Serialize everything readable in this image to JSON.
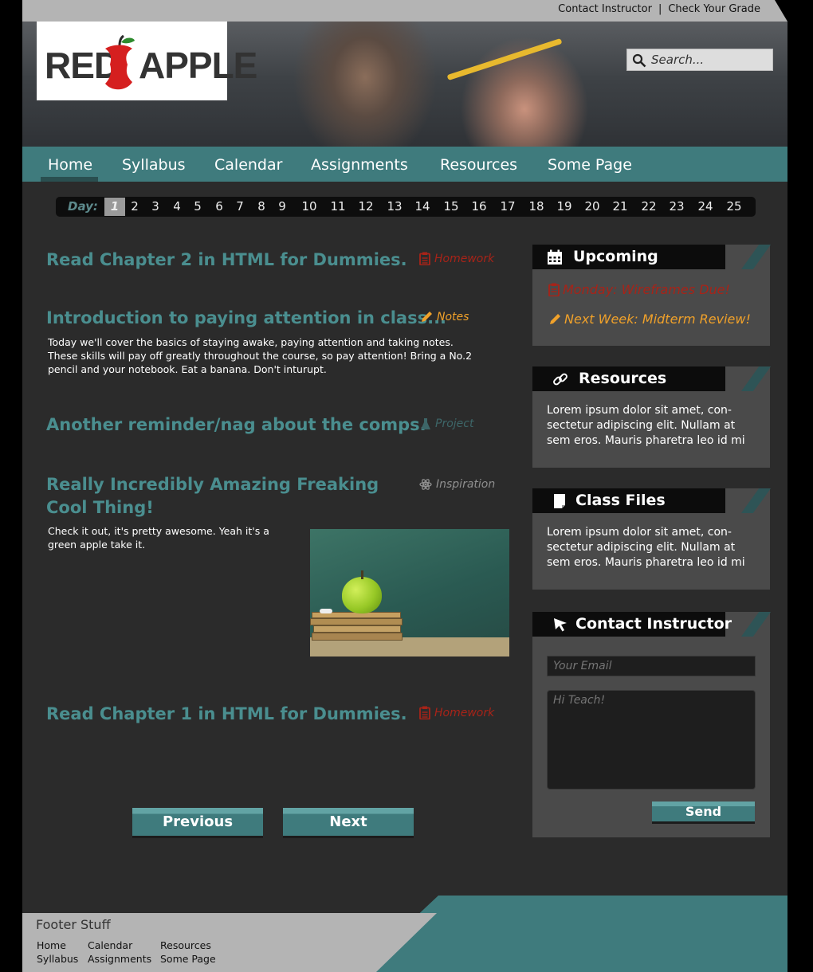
{
  "topbar": {
    "contact": "Contact Instructor",
    "separator": "|",
    "grade": "Check Your Grade"
  },
  "logo": {
    "left_word": "RED",
    "right_word": "APPLE"
  },
  "search": {
    "placeholder": "Search..."
  },
  "nav": {
    "items": [
      "Home",
      "Syllabus",
      "Calendar",
      "Assignments",
      "Resources",
      "Some Page"
    ],
    "active": "Home"
  },
  "daybar": {
    "label": "Day:",
    "active": "1",
    "days": [
      "1",
      "2",
      "3",
      "4",
      "5",
      "6",
      "7",
      "8",
      "9",
      "10",
      "11",
      "12",
      "13",
      "14",
      "15",
      "16",
      "17",
      "18",
      "19",
      "20",
      "21",
      "22",
      "23",
      "24",
      "25"
    ]
  },
  "posts": [
    {
      "title": "Read Chapter 2 in HTML for Dummies.",
      "tag": "Homework",
      "tag_icon": "clipboard-icon"
    },
    {
      "title": "Introduction to paying attention in class...",
      "tag": "Notes",
      "tag_icon": "pencil-icon",
      "body": "Today we'll cover the basics of staying awake, paying attention and taking notes. These skills will pay off greatly throughout the course, so pay attention! Bring a No.2 pencil and your notebook. Eat a banana. Don't inturupt."
    },
    {
      "title": "Another reminder/nag about the comps.",
      "tag": "Project",
      "tag_icon": "flask-icon"
    },
    {
      "title_line1": "Really Incredibly Amazing Freaking",
      "title_line2": "Cool Thing!",
      "tag": "Inspiration",
      "tag_icon": "atom-icon",
      "body": "Check it out, it's pretty awesome. Yeah it's a green apple take it."
    },
    {
      "title": "Read Chapter 1 in HTML for Dummies.",
      "tag": "Homework",
      "tag_icon": "clipboard-icon"
    }
  ],
  "pager": {
    "previous": "Previous",
    "next": "Next"
  },
  "sidebar": {
    "upcoming": {
      "title": "Upcoming",
      "items": [
        {
          "text": "Monday: Wireframes Due!",
          "icon": "clipboard-icon"
        },
        {
          "text": "Next Week: Midterm Review!",
          "icon": "pencil-icon"
        }
      ]
    },
    "resources": {
      "title": "Resources",
      "text": "Lorem ipsum dolor sit amet, con-sectetur adipiscing elit. Nullam at sem eros. Mauris pharetra leo id mi"
    },
    "class_files": {
      "title": "Class Files",
      "text": "Lorem ipsum dolor sit amet, con-sectetur adipiscing elit. Nullam at sem eros. Mauris pharetra leo id mi"
    },
    "contact": {
      "title": "Contact Instructor",
      "email_placeholder": "Your Email",
      "message_placeholder": "Hi Teach!",
      "send": "Send"
    }
  },
  "footer": {
    "title": "Footer Stuff",
    "links": [
      "Home",
      "Syllabus",
      "Calendar",
      "Assignments",
      "Resources",
      "Some Page"
    ]
  },
  "colors": {
    "teal": "#3f7b7d",
    "teal_text": "#4a8e8f",
    "homework": "#a82318",
    "notes": "#f0a12a",
    "project": "#3d6668",
    "inspiration": "#8f8f8f"
  }
}
